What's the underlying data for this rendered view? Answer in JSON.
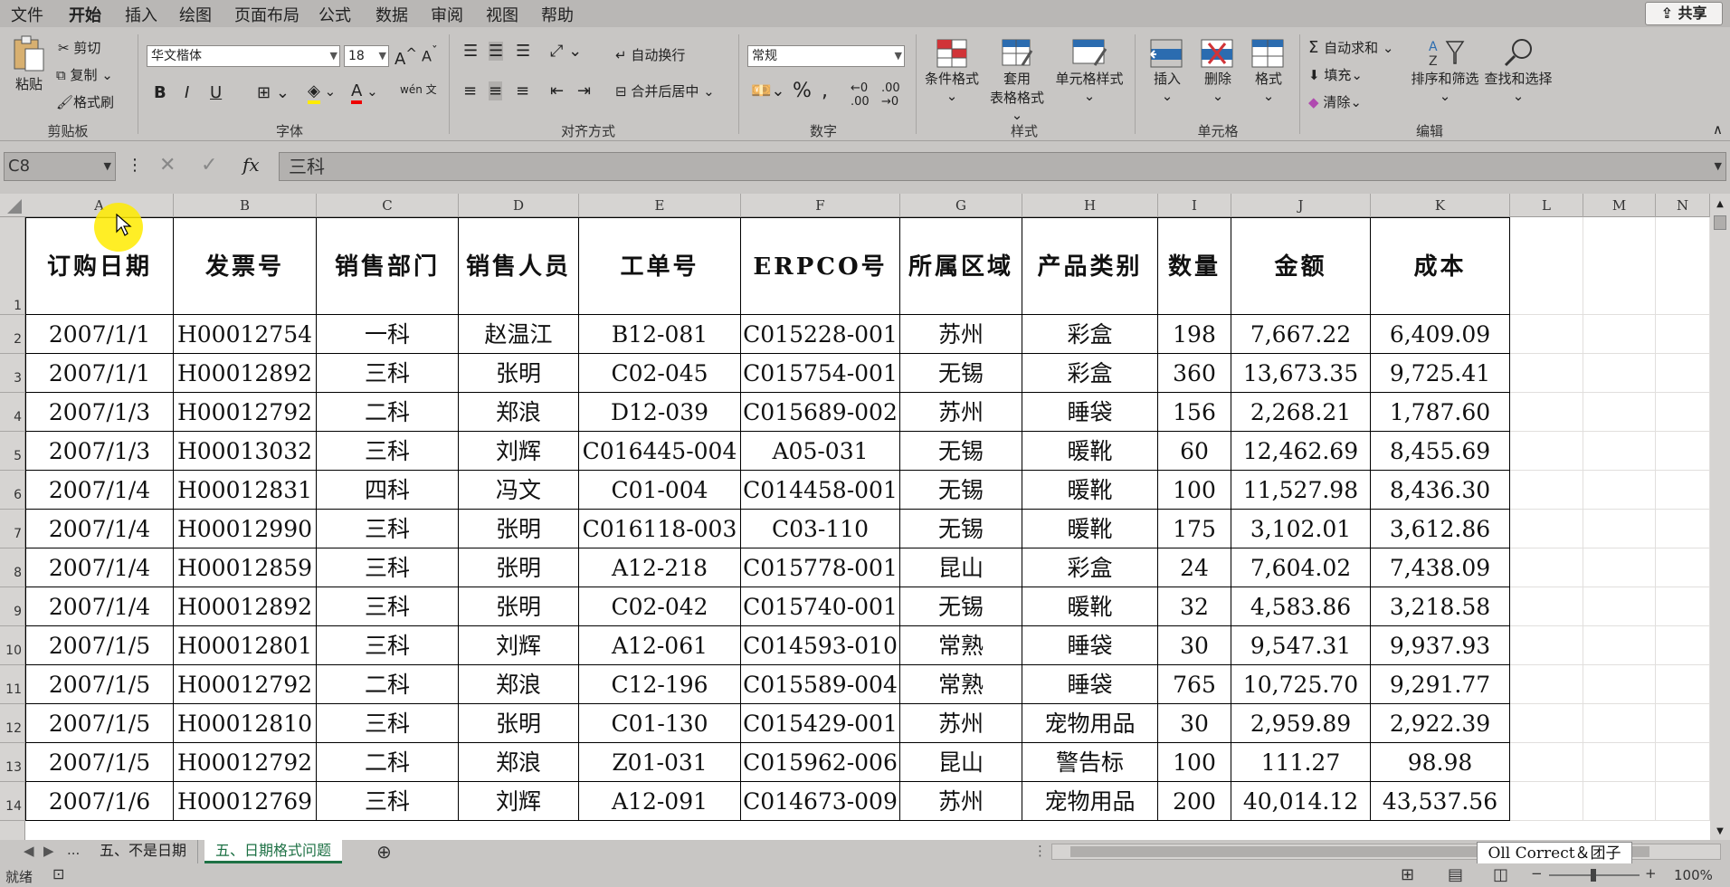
{
  "menu": [
    "文件",
    "开始",
    "插入",
    "绘图",
    "页面布局",
    "公式",
    "数据",
    "审阅",
    "视图",
    "帮助"
  ],
  "share_label": "共享",
  "ribbon": {
    "clipboard": {
      "paste": "粘贴",
      "cut": "剪切",
      "copy": "复制",
      "format_painter": "格式刷",
      "group": "剪贴板"
    },
    "font": {
      "name": "华文楷体",
      "size": "18",
      "bold": "B",
      "italic": "I",
      "underline": "U",
      "group": "字体"
    },
    "alignment": {
      "wrap": "自动换行",
      "merge": "合并后居中",
      "group": "对齐方式"
    },
    "number": {
      "format": "常规",
      "percent": "%",
      "group": "数字"
    },
    "styles": {
      "conditional": "条件格式",
      "table_line1": "套用",
      "table_line2": "表格格式",
      "cell_styles": "单元格样式",
      "group": "样式"
    },
    "cells": {
      "insert": "插入",
      "delete": "删除",
      "format": "格式",
      "group": "单元格"
    },
    "editing": {
      "autosum": "自动求和",
      "fill": "填充",
      "clear": "清除",
      "sort": "排序和筛选",
      "find": "查找和选择",
      "group": "编辑"
    }
  },
  "formula_bar": {
    "name_box": "C8",
    "fx": "fx",
    "value": "三科"
  },
  "columns": [
    "A",
    "B",
    "C",
    "D",
    "E",
    "F",
    "G",
    "H",
    "I",
    "J",
    "K",
    "L",
    "M",
    "N"
  ],
  "headers": [
    "订购日期",
    "发票号",
    "销售部门",
    "销售人员",
    "工单号",
    "ERPCO号",
    "所属区域",
    "产品类别",
    "数量",
    "金额",
    "成本"
  ],
  "rows": [
    [
      "2007/1/1",
      "H00012754",
      "一科",
      "赵温江",
      "B12-081",
      "C015228-001",
      "苏州",
      "彩盒",
      "198",
      "7,667.22",
      "6,409.09"
    ],
    [
      "2007/1/1",
      "H00012892",
      "三科",
      "张明",
      "C02-045",
      "C015754-001",
      "无锡",
      "彩盒",
      "360",
      "13,673.35",
      "9,725.41"
    ],
    [
      "2007/1/3",
      "H00012792",
      "二科",
      "郑浪",
      "D12-039",
      "C015689-002",
      "苏州",
      "睡袋",
      "156",
      "2,268.21",
      "1,787.60"
    ],
    [
      "2007/1/3",
      "H00013032",
      "三科",
      "刘辉",
      "C016445-004",
      "A05-031",
      "无锡",
      "暖靴",
      "60",
      "12,462.69",
      "8,455.69"
    ],
    [
      "2007/1/4",
      "H00012831",
      "四科",
      "冯文",
      "C01-004",
      "C014458-001",
      "无锡",
      "暖靴",
      "100",
      "11,527.98",
      "8,436.30"
    ],
    [
      "2007/1/4",
      "H00012990",
      "三科",
      "张明",
      "C016118-003",
      "C03-110",
      "无锡",
      "暖靴",
      "175",
      "3,102.01",
      "3,612.86"
    ],
    [
      "2007/1/4",
      "H00012859",
      "三科",
      "张明",
      "A12-218",
      "C015778-001",
      "昆山",
      "彩盒",
      "24",
      "7,604.02",
      "7,438.09"
    ],
    [
      "2007/1/4",
      "H00012892",
      "三科",
      "张明",
      "C02-042",
      "C015740-001",
      "无锡",
      "暖靴",
      "32",
      "4,583.86",
      "3,218.58"
    ],
    [
      "2007/1/5",
      "H00012801",
      "三科",
      "刘辉",
      "A12-061",
      "C014593-010",
      "常熟",
      "睡袋",
      "30",
      "9,547.31",
      "9,937.93"
    ],
    [
      "2007/1/5",
      "H00012792",
      "二科",
      "郑浪",
      "C12-196",
      "C015589-004",
      "常熟",
      "睡袋",
      "765",
      "10,725.70",
      "9,291.77"
    ],
    [
      "2007/1/5",
      "H00012810",
      "三科",
      "张明",
      "C01-130",
      "C015429-001",
      "苏州",
      "宠物用品",
      "30",
      "2,959.89",
      "2,922.39"
    ],
    [
      "2007/1/5",
      "H00012792",
      "二科",
      "郑浪",
      "Z01-031",
      "C015962-006",
      "昆山",
      "警告标",
      "100",
      "111.27",
      "98.98"
    ],
    [
      "2007/1/6",
      "H00012769",
      "三科",
      "刘辉",
      "A12-091",
      "C014673-009",
      "苏州",
      "宠物用品",
      "200",
      "40,014.12",
      "43,537.56"
    ]
  ],
  "row_numbers": [
    "1",
    "2",
    "3",
    "4",
    "5",
    "6",
    "7",
    "8",
    "9",
    "10",
    "11",
    "12",
    "13",
    "14"
  ],
  "sheets": [
    "五、不是日期",
    "五、日期格式问题"
  ],
  "active_sheet": 1,
  "watermark": "Oll Correct＆团子",
  "status": {
    "ready": "就绪",
    "zoom": "100%"
  },
  "colors": {
    "accent": "#1e7145",
    "cursor": "#ffeb00"
  }
}
